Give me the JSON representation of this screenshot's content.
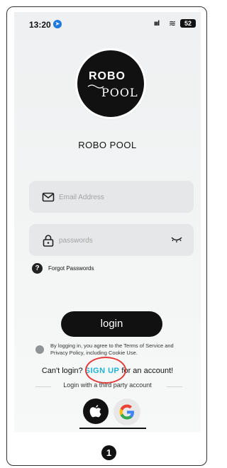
{
  "status_bar": {
    "time": "13:20",
    "battery": "52"
  },
  "brand": {
    "logo_line1": "ROBO",
    "logo_line2": "POOL",
    "app_name": "ROBO POOL"
  },
  "login_form": {
    "email_placeholder": "Email Address",
    "password_placeholder": "passwords",
    "forgot_label": "Forgot Passwords",
    "login_button": "login"
  },
  "agreement": {
    "text": "By logging in, you agree to the Terms of Service and Privacy Policy, including Cookie Use."
  },
  "signup": {
    "prefix": "Can't login? ",
    "link": "SIGN UP",
    "suffix": " for an account!"
  },
  "third_party": {
    "label": "Login with a third party account",
    "providers": [
      "apple-icon",
      "google-icon"
    ]
  },
  "annotation": {
    "step": "1"
  },
  "colors": {
    "accent": "#1eb3d6",
    "highlight_circle": "#e33b3b",
    "button": "#111111"
  }
}
